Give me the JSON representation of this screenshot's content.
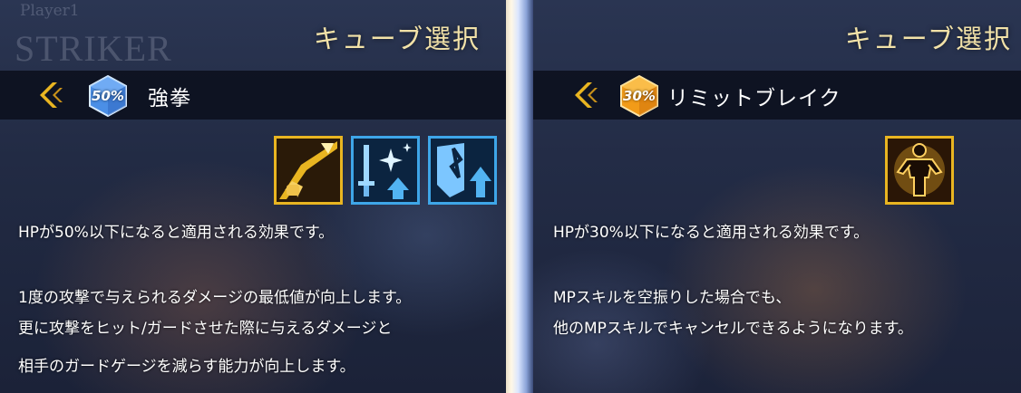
{
  "left_panel": {
    "watermark_player": "Player1",
    "watermark_name": "STRIKER",
    "title": "キューブ選択",
    "cube": {
      "percent": "50%",
      "color": "blue",
      "name": "強拳"
    },
    "skills": [
      "fist-upgrade-icon",
      "sword-sparkle-up-icon",
      "shield-break-up-icon"
    ],
    "desc_condition": "HPが50%以下になると適用される効果です。",
    "desc_effect": [
      "1度の攻撃で与えられるダメージの最低値が向上します。",
      "更に攻撃をヒット/ガードさせた際に与えるダメージと",
      "相手のガードゲージを減らす能力が向上します。"
    ]
  },
  "right_panel": {
    "title": "キューブ選択",
    "cube": {
      "percent": "30%",
      "color": "orange",
      "name": "リミットブレイク"
    },
    "skills": [
      "limit-break-aura-icon"
    ],
    "desc_condition": "HPが30%以下になると適用される効果です。",
    "desc_effect": [
      "MPスキルを空振りした場合でも、",
      "他のMPスキルでキャンセルできるようになります。"
    ]
  },
  "colors": {
    "title_gold": "#f2e2a8",
    "gold_frame": "#e9b521",
    "blue_frame": "#3ea6e8",
    "cube_blue": "#4b8fe6",
    "cube_orange": "#f29b18"
  }
}
